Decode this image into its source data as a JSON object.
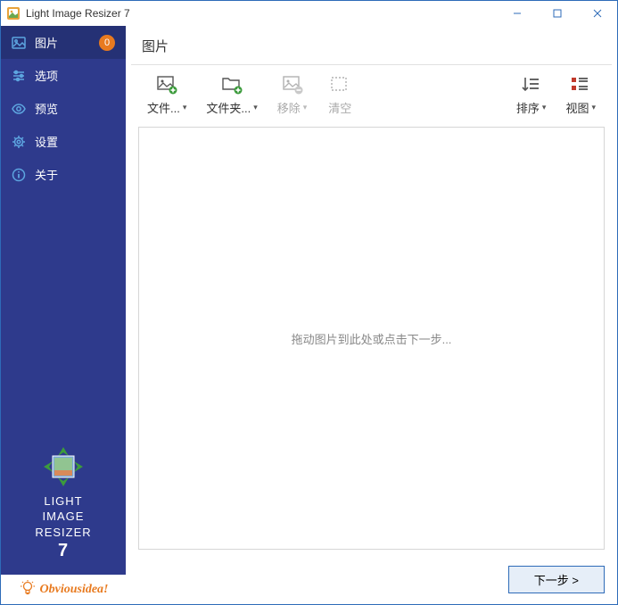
{
  "window": {
    "title": "Light Image Resizer 7"
  },
  "sidebar": {
    "items": [
      {
        "label": "图片",
        "badge": "0"
      },
      {
        "label": "选项"
      },
      {
        "label": "预览"
      },
      {
        "label": "设置"
      },
      {
        "label": "关于"
      }
    ],
    "logo": {
      "line1": "LIGHT",
      "line2": "IMAGE",
      "line3": "RESIZER",
      "line4": "7"
    },
    "obvious": "Obviousidea!"
  },
  "content": {
    "title": "图片",
    "toolbar": {
      "files": "文件...",
      "folders": "文件夹...",
      "remove": "移除",
      "clear": "清空",
      "sort": "排序",
      "view": "视图"
    },
    "placeholder": "拖动图片到此处或点击下一步...",
    "next": "下一步 >"
  }
}
